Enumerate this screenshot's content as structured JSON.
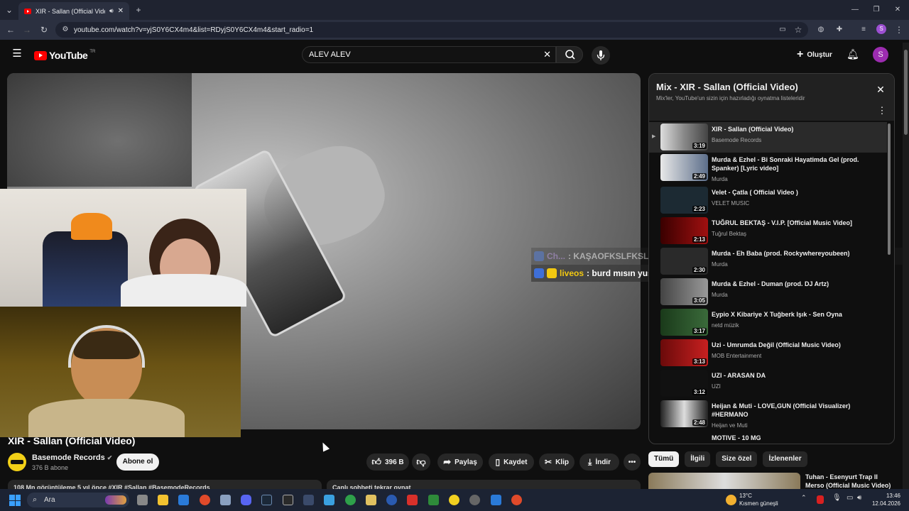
{
  "browser": {
    "tab_title": "XIR - Sallan (Official Video)",
    "url": "youtube.com/watch?v=yjS0Y6CX4m4&list=RDyjS0Y6CX4m4&start_radio=1",
    "new_tab_label": "+"
  },
  "masthead": {
    "logo": "YouTube",
    "logo_region": "TR",
    "search_value": "ALEV ALEV",
    "create_label": "Oluştur",
    "avatar_letter": "S"
  },
  "video": {
    "title": "XIR - Sallan (Official Video)",
    "channel": "Basemode Records",
    "subscribers": "376 B abone",
    "subscribe_label": "Abone ol",
    "likes": "396 B",
    "share_label": "Paylaş",
    "save_label": "Kaydet",
    "clip_label": "Klip",
    "download_label": "İndir",
    "description_preview": "108 Mn görüntüleme  5 yıl önce  #XIR #Sallan #BasemodeRecords",
    "live_chat_label": "Canlı sohbeti tekrar oynat"
  },
  "chat_overlay": [
    {
      "user": "Ch...",
      "message": ": KAŞAOFKSLFKSLFLSLLYSL",
      "color": "#5b3a8a"
    },
    {
      "user": "liveos",
      "message": ": burd mısın yuspac",
      "color": "#f2c811"
    }
  ],
  "playlist": {
    "title": "Mix - XIR - Sallan (Official Video)",
    "subtitle": "Mix'ler, YouTube'un sizin için hazırladığı oynatma listeleridir",
    "items": [
      {
        "title": "XIR - Sallan (Official Video)",
        "channel": "Basemode Records",
        "duration": "3:19"
      },
      {
        "title": "Murda & Ezhel - Bi Sonraki Hayatimda Gel (prod. Spanker) [Lyric video]",
        "channel": "Murda",
        "duration": "2:49"
      },
      {
        "title": "Velet - Çatla ( Official Video )",
        "channel": "VELET MUSIC",
        "duration": "2:23"
      },
      {
        "title": "TUĞRUL BEKTAŞ - V.I.P. [Official Music Video]",
        "channel": "Tuğrul Bektaş",
        "duration": "2:13"
      },
      {
        "title": "Murda - Eh Baba (prod. Rockywhereyoubeen)",
        "channel": "Murda",
        "duration": "2:30"
      },
      {
        "title": "Murda & Ezhel - Duman (prod. DJ Artz)",
        "channel": "Murda",
        "duration": "3:05"
      },
      {
        "title": "Eypio X Kibariye X Tuğberk Işık - Sen Oyna",
        "channel": "netd müzik",
        "duration": "3:17"
      },
      {
        "title": "Uzi - Umrumda Değil (Official Music Video)",
        "channel": "MOB Entertainment",
        "duration": "3:13"
      },
      {
        "title": "UZI - ARASAN DA",
        "channel": "UZI",
        "duration": "3:12"
      },
      {
        "title": "Heijan & Muti - LOVE,GUN (Official Visualizer) #HERMANO",
        "channel": "Heijan ve Muti",
        "duration": "2:48"
      },
      {
        "title": "MOTIVE - 10 MG",
        "channel": "",
        "duration": ""
      }
    ]
  },
  "chips": [
    "Tümü",
    "İlgili",
    "Size özel",
    "İzlenenler"
  ],
  "next_video": {
    "title": "Tuhan - Esenyurt Trap II Merso (Official Music Video)"
  },
  "taskbar": {
    "search_label": "Ara",
    "temperature": "13°C",
    "weather": "Kısmen güneşli",
    "time": "13:46",
    "date": "12.04.2026"
  }
}
